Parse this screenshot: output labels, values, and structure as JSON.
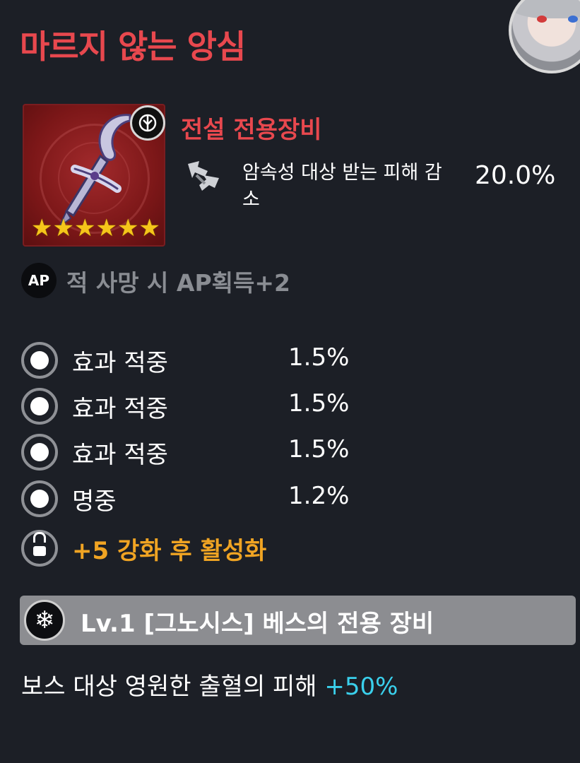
{
  "item": {
    "name": "마르지 않는 앙심",
    "grade_label": "전설 전용장비",
    "stars": 6,
    "main_stat": {
      "label": "암속성 대상 받는 피해 감소",
      "value": "20.0%"
    }
  },
  "ap": {
    "icon_text": "AP",
    "text": "적 사망 시 AP획득+2"
  },
  "substats": [
    {
      "name": "효과 적중",
      "value": "1.5%"
    },
    {
      "name": "효과 적중",
      "value": "1.5%"
    },
    {
      "name": "효과 적중",
      "value": "1.5%"
    },
    {
      "name": "명중",
      "value": "1.2%"
    }
  ],
  "locked": {
    "text": "+5 강화 후 활성화",
    "icon": "lock-icon"
  },
  "set": {
    "label": "Lv.1 [그노시스] 베스의 전용 장비",
    "icon": "snowflake-icon",
    "effect_text": "보스 대상 영원한 출혈의 피해 ",
    "effect_value": "+50%"
  },
  "colors": {
    "title": "#e8484e",
    "locked": "#f0a423",
    "effect_value": "#3ad0ec",
    "background": "#1c1f26"
  }
}
